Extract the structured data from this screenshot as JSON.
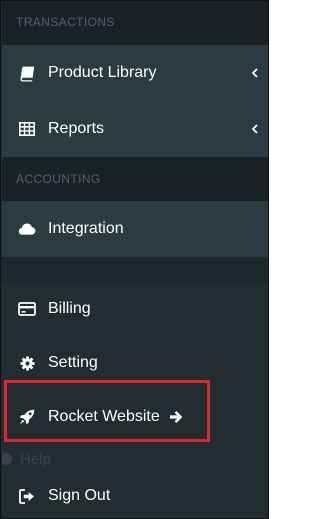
{
  "sections": {
    "transactions": "TRANSACTIONS",
    "accounting": "ACCOUNTING"
  },
  "items": {
    "product_library": {
      "label": "Product Library",
      "icon": "book-icon",
      "has_chevron": true
    },
    "reports": {
      "label": "Reports",
      "icon": "table-icon",
      "has_chevron": true
    },
    "integration": {
      "label": "Integration",
      "icon": "cloud-icon"
    },
    "billing": {
      "label": "Billing",
      "icon": "credit-card-icon"
    },
    "setting": {
      "label": "Setting",
      "icon": "gear-icon"
    },
    "rocket_website": {
      "label": "Rocket Website",
      "icon": "rocket-icon",
      "trailing_icon": "arrow-right-icon"
    },
    "help": {
      "label": "Help",
      "icon": "question-circle-icon"
    },
    "sign_out": {
      "label": "Sign Out",
      "icon": "sign-out-icon"
    }
  },
  "colors": {
    "sidebar_bg": "#222d32",
    "active_band": "#2c3b41",
    "section_header_bg": "#1a2226",
    "section_header_text": "#4b646f",
    "item_text": "#ffffff",
    "highlight_border": "#e0262c"
  }
}
